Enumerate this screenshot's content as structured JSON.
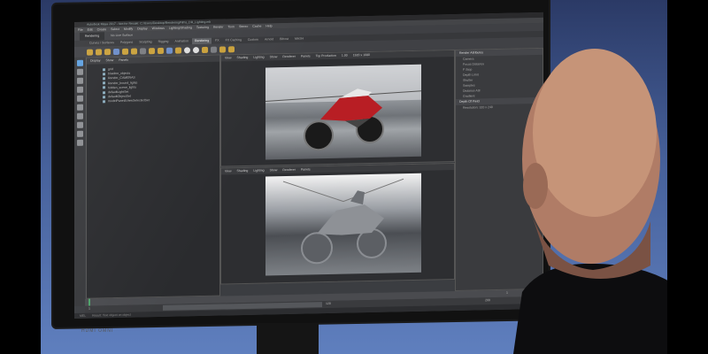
{
  "app": {
    "title": "Autodesk Maya 2017 - Not for Resale: C:/Users/Desktop/RenderingFilms_DR_Lighting.mb",
    "menus": [
      "File",
      "Edit",
      "Create",
      "Select",
      "Modify",
      "Display",
      "Windows",
      "Lighting/Shading",
      "Texturing",
      "Render",
      "Toon",
      "Stereo",
      "Cache",
      "Help"
    ],
    "mode": "Rendering",
    "live_surface": "No Live Surface"
  },
  "shelf_tabs": [
    "Curves / Surfaces",
    "Polygons",
    "Sculpting",
    "Rigging",
    "Animation",
    "Rendering",
    "FX",
    "FX Caching",
    "Custom",
    "Arnold",
    "Bifrost",
    "MASH"
  ],
  "active_shelf_tab": "Rendering",
  "outliner": {
    "menu": [
      "Display",
      "Show",
      "Panels"
    ],
    "items": [
      "grid",
      "blueline_objects",
      "Render_CAMERAS",
      "Render_bound_lights",
      "hidden_scene_lights",
      "defaultLightSet",
      "defaultObjectSet",
      "modelPanel4ViewSelectedSet"
    ]
  },
  "viewport_top": {
    "menu": [
      "View",
      "Shading",
      "Lighting",
      "Show",
      "Renderer",
      "Panels"
    ],
    "camera": "Top Production",
    "zoom": "1.00",
    "resolution": "1920 x 1080"
  },
  "viewport_bottom": {
    "menu": [
      "View",
      "Shading",
      "Lighting",
      "Show",
      "Renderer",
      "Panels"
    ]
  },
  "attribute_editor": {
    "header": "Render Attributes",
    "rows": [
      "Camera",
      "Focus Distance",
      "F Stop",
      "Depth Limit",
      "Shutter",
      "Samples",
      "Distance Attr",
      "Gradient"
    ],
    "section": "Depth Of Field",
    "readout": "Resolution: 320 x 240"
  },
  "timeline": {
    "start": "1",
    "end": "120",
    "range_end": "200",
    "current": "1"
  },
  "command_line": {
    "label": "MEL",
    "text": "Result: Text object on object"
  },
  "monitor": {
    "brand": "HDMI  OMNI"
  }
}
